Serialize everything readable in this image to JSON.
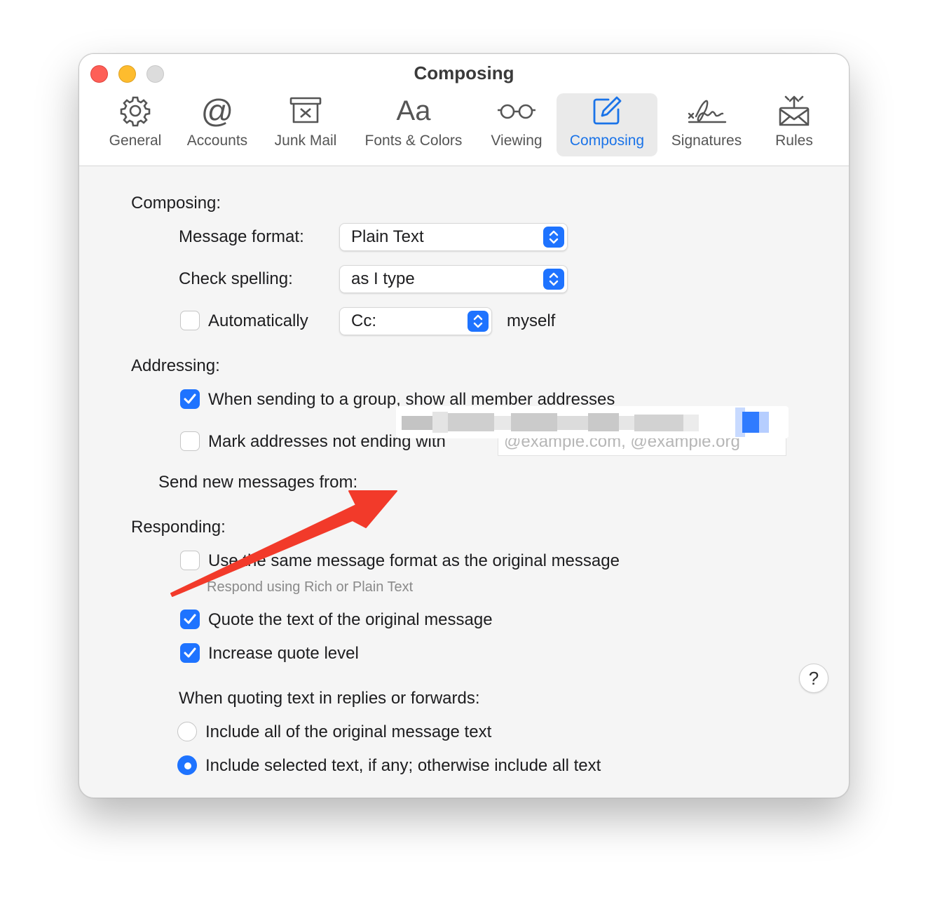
{
  "window": {
    "title": "Composing"
  },
  "toolbar": [
    {
      "id": "general",
      "label": "General",
      "icon": "gear-icon"
    },
    {
      "id": "accounts",
      "label": "Accounts",
      "icon": "at-sign-icon"
    },
    {
      "id": "junk",
      "label": "Junk Mail",
      "icon": "junk-bin-icon"
    },
    {
      "id": "fonts",
      "label": "Fonts & Colors",
      "icon": "font-aa-icon",
      "glyph": "Aa"
    },
    {
      "id": "viewing",
      "label": "Viewing",
      "icon": "glasses-icon"
    },
    {
      "id": "composing",
      "label": "Composing",
      "icon": "compose-pencil-icon",
      "active": true
    },
    {
      "id": "signatures",
      "label": "Signatures",
      "icon": "signature-icon"
    },
    {
      "id": "rules",
      "label": "Rules",
      "icon": "rules-envelope-icon"
    }
  ],
  "composing": {
    "heading": "Composing:",
    "message_format_label": "Message format:",
    "message_format_value": "Plain Text",
    "check_spelling_label": "Check spelling:",
    "check_spelling_value": "as I type",
    "auto_label": "Automatically",
    "auto_checked": false,
    "auto_value": "Cc:",
    "auto_suffix": "myself"
  },
  "addressing": {
    "heading": "Addressing:",
    "group_label": "When sending to a group, show all member addresses",
    "group_checked": true,
    "mark_label": "Mark addresses not ending with",
    "mark_checked": false,
    "mark_placeholder": "@example.com, @example.org",
    "send_from_label": "Send new messages from:"
  },
  "responding": {
    "heading": "Responding:",
    "same_format_label": "Use the same message format as the original message",
    "same_format_checked": false,
    "same_format_sub": "Respond using Rich or Plain Text",
    "quote_label": "Quote the text of the original message",
    "quote_checked": true,
    "increase_label": "Increase quote level",
    "increase_checked": true,
    "quoting_heading": "When quoting text in replies or forwards:",
    "option_all": "Include all of the original message text",
    "option_selected": "Include selected text, if any; otherwise include all text",
    "selected_option": "selected"
  },
  "help_label": "?",
  "colors": {
    "accent": "#1e73ff",
    "arrow": "#f23a2a",
    "close": "#fe5f57",
    "minimize": "#febc2e"
  }
}
